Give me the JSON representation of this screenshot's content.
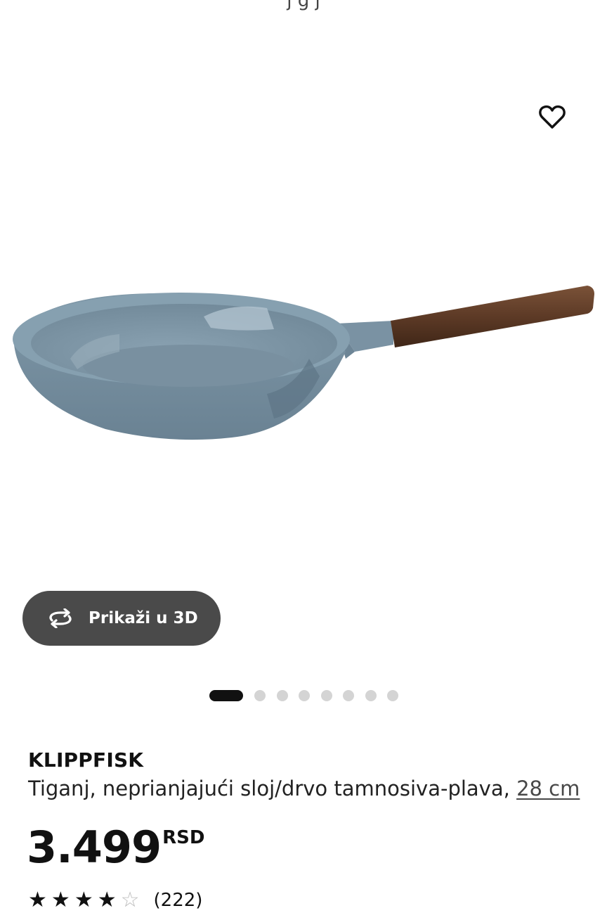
{
  "top_cut_text": "j  g  j",
  "gallery": {
    "favorite_icon": "heart-outline-icon",
    "view_3d_label": "Prikaži u 3D",
    "view_3d_icon": "rotate-3d-icon",
    "slides_total": 8,
    "active_slide": 1
  },
  "product": {
    "name": "KLIPPFISK",
    "description": "Tiganj, neprianjajući sloj/drvo tamnosiva-plava, ",
    "size_link": "28 cm",
    "price": "3.499",
    "currency": "RSD",
    "rating_stars": 4,
    "rating_count": "(222)"
  },
  "colors": {
    "button_bg": "#4a4a4a",
    "active_dot": "#111111",
    "inactive_dot": "#d4d4d4"
  }
}
